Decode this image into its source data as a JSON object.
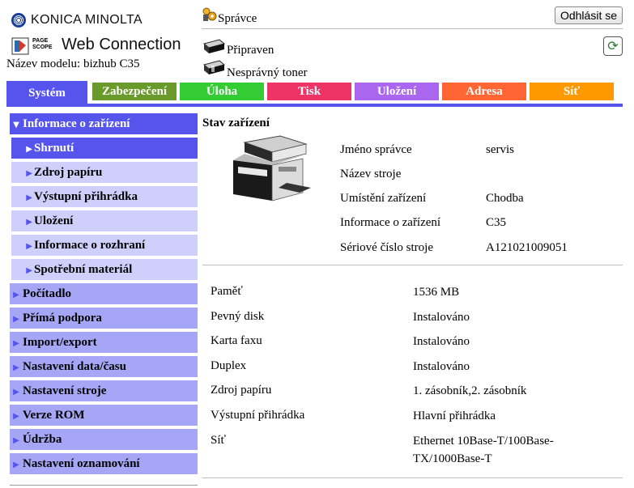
{
  "brand": {
    "name": "KONICA MINOLTA",
    "page_scope": "PAGE SCOPE",
    "app": "Web Connection"
  },
  "model_label": "Název modelu: bizhub C35",
  "header": {
    "admin": "Správce",
    "logout": "Odhlásit se",
    "status1": "Připraven",
    "status2": "Nesprávný toner"
  },
  "tabs": [
    {
      "label": "Systém",
      "color": "#5555ee"
    },
    {
      "label": "Zabezpečení",
      "color": "#6a9a2a"
    },
    {
      "label": "Úloha",
      "color": "#33cc33"
    },
    {
      "label": "Tisk",
      "color": "#ee3366"
    },
    {
      "label": "Uložení",
      "color": "#aa66ee"
    },
    {
      "label": "Adresa",
      "color": "#ff6633"
    },
    {
      "label": "Síť",
      "color": "#ff9900"
    }
  ],
  "sidebar": [
    "Informace o zařízení",
    "Shrnutí",
    "Zdroj papíru",
    "Výstupní přihrádka",
    "Uložení",
    "Informace o rozhraní",
    "Spotřební materiál",
    "Počítadlo",
    "Přímá podpora",
    "Import/export",
    "Nastavení data/času",
    "Nastavení stroje",
    "Verze ROM",
    "Údržba",
    "Nastavení oznamování"
  ],
  "main": {
    "title": "Stav zařízení",
    "info": [
      {
        "k": "Jméno správce",
        "v": "servis"
      },
      {
        "k": "Název stroje",
        "v": ""
      },
      {
        "k": "Umístění zařízení",
        "v": "Chodba"
      },
      {
        "k": "Informace o zařízení",
        "v": "C35"
      },
      {
        "k": "Sériové číslo stroje",
        "v": "A121021009051"
      }
    ],
    "specs": [
      {
        "k": "Paměť",
        "v": "1536 MB"
      },
      {
        "k": "Pevný disk",
        "v": "Instalováno"
      },
      {
        "k": "Karta faxu",
        "v": "Instalováno"
      },
      {
        "k": "Duplex",
        "v": "Instalováno"
      },
      {
        "k": "Zdroj papíru",
        "v": "1. zásobník,2. zásobník"
      },
      {
        "k": "Výstupní přihrádka",
        "v": "Hlavní přihrádka"
      },
      {
        "k": "Síť",
        "v": "Ethernet 10Base-T/100Base-TX/1000Base-T"
      }
    ]
  },
  "icons": {
    "admin": "admin-icon",
    "printer": "printer-icon",
    "refresh": "refresh-icon"
  }
}
